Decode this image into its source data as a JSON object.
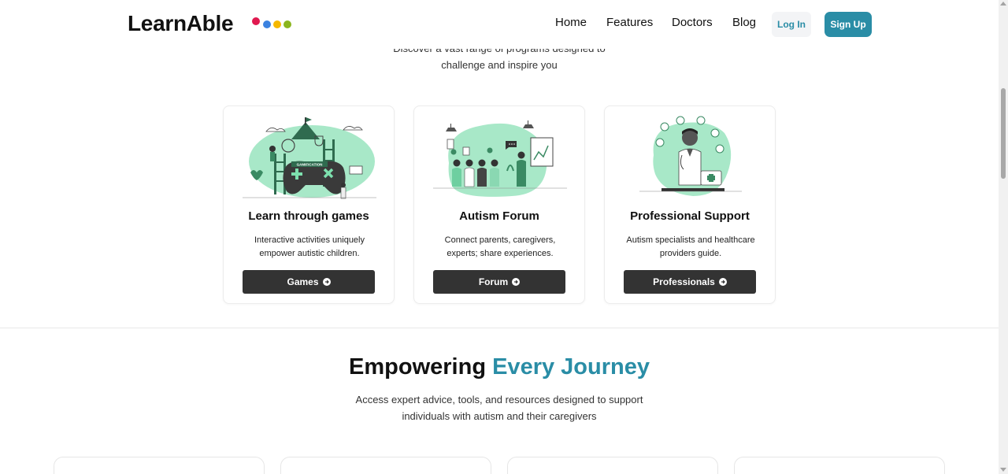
{
  "brand": {
    "name": "LearnAble",
    "dot_colors": [
      "#e0194f",
      "#3b82e0",
      "#f5b800",
      "#8bb51e"
    ]
  },
  "nav": {
    "items": [
      "Home",
      "Features",
      "Doctors",
      "Blog"
    ],
    "login_label": "Log In",
    "signup_label": "Sign Up"
  },
  "intro": {
    "line1": "Discover a vast range of programs designed to",
    "line2": "challenge and inspire you"
  },
  "cards": [
    {
      "title": "Learn through games",
      "desc_line1": "Interactive activities uniquely",
      "desc_line2": "empower autistic children.",
      "button": "Games",
      "illustration": "gamification-illustration"
    },
    {
      "title": "Autism Forum",
      "desc_line1": "Connect parents, caregivers,",
      "desc_line2": "experts; share experiences.",
      "button": "Forum",
      "illustration": "forum-illustration"
    },
    {
      "title": "Professional Support",
      "desc_line1": "Autism specialists and healthcare",
      "desc_line2": "providers guide.",
      "button": "Professionals",
      "illustration": "doctor-illustration"
    }
  ],
  "section": {
    "title_plain": "Empowering",
    "title_accent": "Every Journey",
    "sub_line1": "Access expert advice, tools, and resources designed to support",
    "sub_line2": "individuals with autism and their caregivers"
  },
  "colors": {
    "accent": "#2a8da6",
    "button_dark": "#333333",
    "illustration_mint": "#9fe3c3"
  }
}
